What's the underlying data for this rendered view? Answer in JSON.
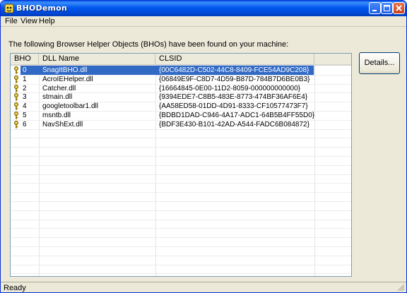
{
  "window": {
    "title": "BHODemon"
  },
  "menu": [
    "File",
    "View",
    "Help"
  ],
  "info": "The following Browser Helper Objects (BHOs) have been found on your machine:",
  "list": {
    "columns": [
      "BHO",
      "DLL Name",
      "CLSID"
    ],
    "rows": [
      {
        "bho": "0",
        "dll": "SnagItBHO.dll",
        "clsid": "{00C6482D-C502-44C8-8409-FCE54AD9C208}",
        "selected": true
      },
      {
        "bho": "1",
        "dll": "AcroIEHelper.dll",
        "clsid": "{06849E9F-C8D7-4D59-B87D-784B7D6BE0B3}"
      },
      {
        "bho": "2",
        "dll": "Catcher.dll",
        "clsid": "{16664845-0E00-11D2-8059-000000000000}"
      },
      {
        "bho": "3",
        "dll": "stmain.dll",
        "clsid": "{9394EDE7-C8B5-483E-8773-474BF36AF6E4}"
      },
      {
        "bho": "4",
        "dll": "googletoolbar1.dll",
        "clsid": "{AA58ED58-01DD-4D91-8333-CF10577473F7}"
      },
      {
        "bho": "5",
        "dll": "msntb.dll",
        "clsid": "{BDBD1DAD-C946-4A17-ADC1-64B5B4FF55D0}"
      },
      {
        "bho": "6",
        "dll": "NavShExt.dll",
        "clsid": "{BDF3E430-B101-42AD-A544-FADC6B084872}"
      }
    ]
  },
  "buttons": {
    "details": "Details..."
  },
  "status": "Ready",
  "icons": {
    "row_icon": "key-icon",
    "app_icon": "bho-demon-icon"
  },
  "colors": {
    "title_bar": "#0058ee",
    "selection": "#316ac5",
    "window_bg": "#ece9d8"
  }
}
